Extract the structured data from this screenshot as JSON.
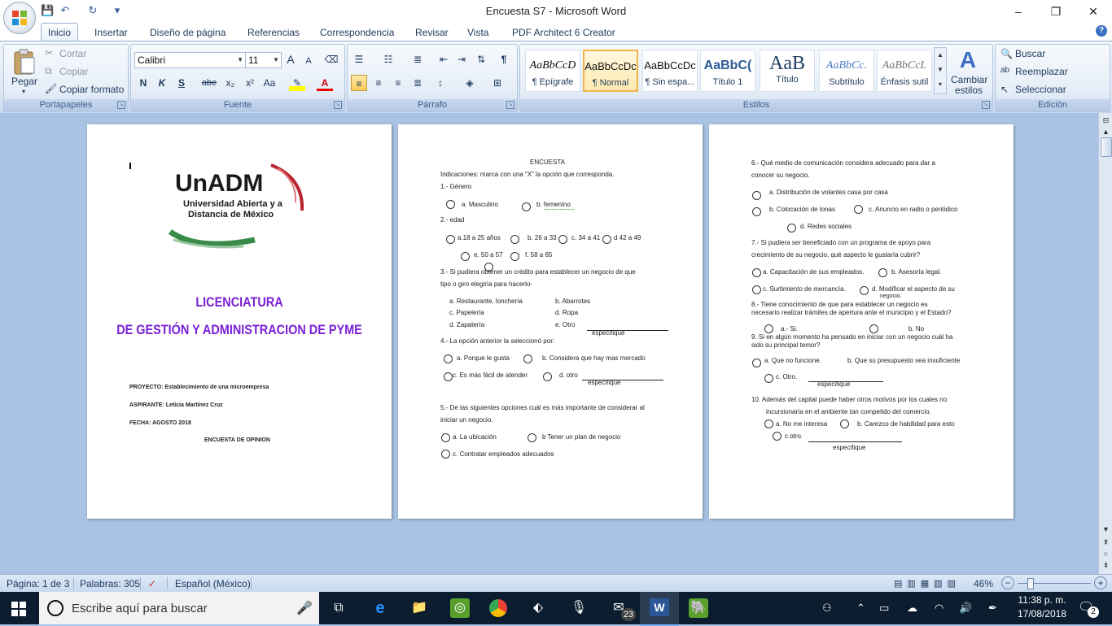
{
  "window": {
    "title": "Encuesta S7 - Microsoft Word",
    "minimize": "–",
    "maximize": "❐",
    "close": "✕"
  },
  "qat": {
    "save": "💾",
    "undo": "↶",
    "redo": "↻",
    "more": "▾"
  },
  "tabs": [
    "Inicio",
    "Insertar",
    "Diseño de página",
    "Referencias",
    "Correspondencia",
    "Revisar",
    "Vista",
    "PDF Architect 6 Creator"
  ],
  "help_icon": "?",
  "ribbon": {
    "portapapeles": {
      "label": "Portapapeles",
      "paste": "Pegar",
      "cut": "Cortar",
      "copy": "Copiar",
      "format_painter": "Copiar formato"
    },
    "fuente": {
      "label": "Fuente",
      "font_name": "Calibri",
      "font_size": "11",
      "bold": "N",
      "italic": "K",
      "underline": "S",
      "strike": "abe",
      "subscript": "x₂",
      "superscript": "x²",
      "change_case": "Aa",
      "grow": "A",
      "shrink": "A"
    },
    "parrafo": {
      "label": "Párrafo"
    },
    "estilos": {
      "label": "Estilos",
      "tiles": [
        {
          "preview": "AaBbCcD",
          "name": "¶ Epígrafe"
        },
        {
          "preview": "AaBbCcDc",
          "name": "¶ Normal"
        },
        {
          "preview": "AaBbCcDc",
          "name": "¶ Sin espa..."
        },
        {
          "preview": "AaBbC(",
          "name": "Título 1"
        },
        {
          "preview": "AaB",
          "name": "Título"
        },
        {
          "preview": "AaBbCc.",
          "name": "Subtítulo"
        },
        {
          "preview": "AaBbCcL",
          "name": "Énfasis sutil"
        }
      ],
      "change_styles": "Cambiar estilos"
    },
    "edicion": {
      "label": "Edición",
      "find": "Buscar",
      "replace": "Reemplazar",
      "select": "Seleccionar"
    }
  },
  "page1": {
    "logo_main": "UnADM",
    "logo_sub1": "Universidad Abierta y a",
    "logo_sub2": "Distancia de México",
    "title1": "LICENCIATURA",
    "title2": "DE GESTIÓN Y ADMINISTRACION DE PYME",
    "proyecto": "PROYECTO: Establecimiento de una microempresa",
    "aspirante": "ASPIRANTE: Leticia Martínez Cruz",
    "fecha": "FECHA: AGOSTO 2018",
    "encuesta": "ENCUESTA DE OPINION"
  },
  "page2": {
    "heading": "ENCUESTA",
    "indicaciones": "Indicaciones: marca con una “X” la opción que corresponda.",
    "q1": "1.- Género",
    "q1a": "a. Masculino",
    "q1b": "b.  femenino",
    "q2": "2.- edad",
    "q2a": "a.18 a 25 años",
    "q2b": "b. 26 a  33",
    "q2c": "c. 34 a 41",
    "q2d": "d 42 a 49",
    "q2e": "e. 50 a 57",
    "q2f": "f.  58 a 65",
    "q3_l1": "3.- Si pudiera obtener un crédito para establecer un negocio de que",
    "q3_l2": "tipo o giro elegiría para hacerlo-",
    "q3a": "a.  Restaurante, lonchería",
    "q3b": "b.    Abarrotes",
    "q3c": "c.  Papelería",
    "q3d": "d.    Ropa",
    "q3e": "d.  Zapatería",
    "q3f": "e.   Otro",
    "especifique": "especifique",
    "q4": "4.- La opción anterior la seleccionó por:",
    "q4a": "a. Porque le gusta",
    "q4b": "b. Considera que hay mas mercado",
    "q4c": "c.  Es más fácil de atender",
    "q4d": "d. otro",
    "q5_l1": "5.- De las siguientes opciones cuál es más importante de considerar al",
    "q5_l2": "iniciar un negocio.",
    "q5a": "a. La ubicación",
    "q5b": "b Tener un plan de negocio",
    "q5c": "c.   Contratar empleados adecuados"
  },
  "page3": {
    "q6_l1": "6.- Qué medio de comunicación considera adecuado para dar a",
    "q6_l2": "conocer su negocio.",
    "q6a": "a. Distribución de volantes casa por casa",
    "q6b": "b. Colocación de lonas",
    "q6c": "c. Anuncio en radio o periódico",
    "q6d": "d. Redes sociales",
    "q7_l1": "7.- Si pudiera ser beneficiado con un programa de apoyo para",
    "q7_l2": "crecimiento de su negocio, qué aspecto le gustaría cubrir?",
    "q7a": "a. Capacitación de sus empleados.",
    "q7b": "b. Asesoría legal.",
    "q7c": "c. Surtimiento de mercancía.",
    "q7d": "d. Modificar el aspecto de su",
    "q7d2": "negocio.",
    "q8_l1": "8.- Tiene conocimiento de que para establecer un negocio es",
    "q8_l2": "necesario realizar trámites de apertura ante el municipio y el Estado?",
    "q8a": "a.- Si.",
    "q8b": "b. No",
    "q9_l1": "9. Si en algún momento ha pensado en iniciar con un negocio cuál ha",
    "q9_l2": "sido su principal temor?",
    "q9a": "a. Que no funcione.",
    "q9b": "b. Que su presupuesto sea insuficiente",
    "q9c": "c. Otro.",
    "especifique": "especifique",
    "q10_l1": "10. Además del capital puede haber otros motivos por los cuales no",
    "q10_l2": "incursionaría en el ambiente tan competido del comercio.",
    "q10a": "a. No me interesa",
    "q10b": "b. Carezco de habilidad para esto",
    "q10c": "c.otro."
  },
  "status": {
    "page": "Página: 1 de 3",
    "words": "Palabras: 305",
    "language": "Español (México)",
    "zoom": "46%",
    "zoom_minus": "−",
    "zoom_plus": "+"
  },
  "taskbar": {
    "search_placeholder": "Escribe aquí para buscar",
    "mail_badge": "23",
    "time": "11:38 p. m.",
    "date": "17/08/2018",
    "notif_count": "2"
  }
}
